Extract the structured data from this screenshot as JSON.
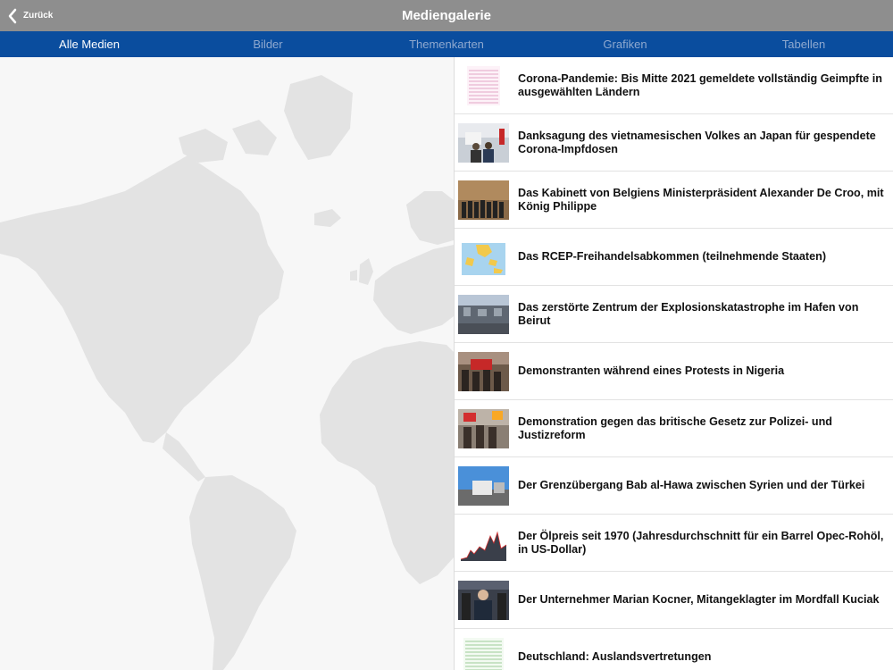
{
  "header": {
    "back_label": "Zurück",
    "title": "Mediengalerie"
  },
  "tabs": [
    {
      "label": "Alle Medien",
      "active": true
    },
    {
      "label": "Bilder",
      "active": false
    },
    {
      "label": "Themenkarten",
      "active": false
    },
    {
      "label": "Grafiken",
      "active": false
    },
    {
      "label": "Tabellen",
      "active": false
    }
  ],
  "media_items": [
    {
      "title": "Corona-Pandemie: Bis Mitte 2021 gemeldete vollständig Geimpfte in ausgewählten Ländern",
      "thumbnail": "table-thumbnail"
    },
    {
      "title": "Danksagung des vietnamesischen Volkes an Japan für gespendete Corona-Impfdosen",
      "thumbnail": "photo-thumbnail"
    },
    {
      "title": "Das Kabinett von Belgiens Ministerpräsident Alexander De Croo, mit König Philippe",
      "thumbnail": "photo-thumbnail"
    },
    {
      "title": "Das RCEP-Freihandelsabkommen (teilnehmende Staaten)",
      "thumbnail": "map-thumbnail"
    },
    {
      "title": "Das zerstörte Zentrum der Explosionskatastrophe im Hafen von Beirut",
      "thumbnail": "photo-thumbnail"
    },
    {
      "title": "Demonstranten während eines Protests in Nigeria",
      "thumbnail": "photo-thumbnail"
    },
    {
      "title": "Demonstration gegen das britische Gesetz zur Polizei- und Justizreform",
      "thumbnail": "photo-thumbnail"
    },
    {
      "title": "Der Grenzübergang Bab al-Hawa zwischen Syrien und der Türkei",
      "thumbnail": "photo-thumbnail"
    },
    {
      "title": "Der Ölpreis seit 1970 (Jahresdurchschnitt für ein Barrel Opec-Rohöl, in US-Dollar)",
      "thumbnail": "chart-thumbnail"
    },
    {
      "title": "Der Unternehmer Marian Kocner, Mitangeklagter im Mordfall Kuciak",
      "thumbnail": "photo-thumbnail"
    },
    {
      "title": "Deutschland: Auslandsvertretungen",
      "thumbnail": "table-thumbnail"
    }
  ],
  "colors": {
    "header_bg": "#8e8e8e",
    "tabbar_bg": "#0a4d9e",
    "tab_active": "#ffffff",
    "tab_inactive": "#8fa9cf",
    "map_land": "#e3e3e3",
    "map_bg": "#f7f7f7"
  }
}
